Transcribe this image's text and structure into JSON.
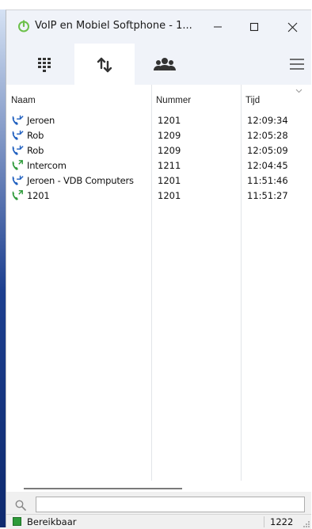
{
  "window": {
    "title": "VoIP en Mobiel Softphone - 1..."
  },
  "toolbar": {
    "tabs": [
      {
        "icon": "dialpad-icon"
      },
      {
        "icon": "call-history-icon"
      },
      {
        "icon": "contacts-icon"
      }
    ],
    "menu_icon": "hamburger-menu-icon"
  },
  "list": {
    "headers": {
      "name": "Naam",
      "number": "Nummer",
      "time": "Tijd"
    },
    "rows": [
      {
        "type": "incoming",
        "name": "Jeroen",
        "number": "1201",
        "time": "12:09:34"
      },
      {
        "type": "incoming",
        "name": "Rob",
        "number": "1209",
        "time": "12:05:28"
      },
      {
        "type": "incoming",
        "name": "Rob",
        "number": "1209",
        "time": "12:05:09"
      },
      {
        "type": "outgoing",
        "name": "Intercom",
        "number": "1211",
        "time": "12:04:45"
      },
      {
        "type": "incoming",
        "name": "Jeroen - VDB Computers",
        "number": "1201",
        "time": "11:51:46"
      },
      {
        "type": "outgoing",
        "name": "1201",
        "number": "1201",
        "time": "11:51:27"
      }
    ]
  },
  "search": {
    "value": "",
    "placeholder": ""
  },
  "status": {
    "text": "Bereikbaar",
    "extension": "1222"
  },
  "colors": {
    "incoming": "#1f5fbf",
    "outgoing": "#2e9b3a",
    "accent": "#2e9b3a"
  }
}
